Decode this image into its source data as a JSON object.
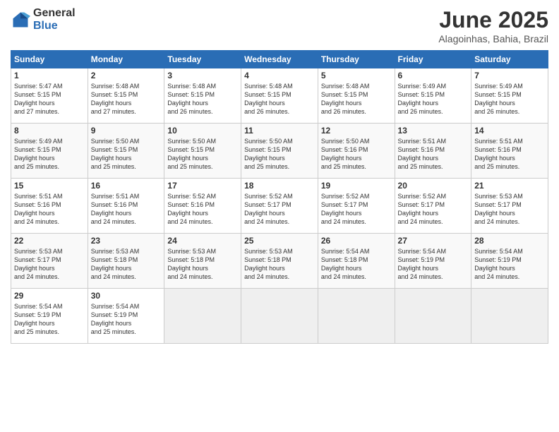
{
  "logo": {
    "general": "General",
    "blue": "Blue"
  },
  "title": "June 2025",
  "location": "Alagoinhas, Bahia, Brazil",
  "days_of_week": [
    "Sunday",
    "Monday",
    "Tuesday",
    "Wednesday",
    "Thursday",
    "Friday",
    "Saturday"
  ],
  "weeks": [
    [
      {
        "day": "1",
        "sunrise": "5:47 AM",
        "sunset": "5:15 PM",
        "daylight": "11 hours and 27 minutes."
      },
      {
        "day": "2",
        "sunrise": "5:48 AM",
        "sunset": "5:15 PM",
        "daylight": "11 hours and 27 minutes."
      },
      {
        "day": "3",
        "sunrise": "5:48 AM",
        "sunset": "5:15 PM",
        "daylight": "11 hours and 26 minutes."
      },
      {
        "day": "4",
        "sunrise": "5:48 AM",
        "sunset": "5:15 PM",
        "daylight": "11 hours and 26 minutes."
      },
      {
        "day": "5",
        "sunrise": "5:48 AM",
        "sunset": "5:15 PM",
        "daylight": "11 hours and 26 minutes."
      },
      {
        "day": "6",
        "sunrise": "5:49 AM",
        "sunset": "5:15 PM",
        "daylight": "11 hours and 26 minutes."
      },
      {
        "day": "7",
        "sunrise": "5:49 AM",
        "sunset": "5:15 PM",
        "daylight": "11 hours and 26 minutes."
      }
    ],
    [
      {
        "day": "8",
        "sunrise": "5:49 AM",
        "sunset": "5:15 PM",
        "daylight": "11 hours and 25 minutes."
      },
      {
        "day": "9",
        "sunrise": "5:50 AM",
        "sunset": "5:15 PM",
        "daylight": "11 hours and 25 minutes."
      },
      {
        "day": "10",
        "sunrise": "5:50 AM",
        "sunset": "5:15 PM",
        "daylight": "11 hours and 25 minutes."
      },
      {
        "day": "11",
        "sunrise": "5:50 AM",
        "sunset": "5:15 PM",
        "daylight": "11 hours and 25 minutes."
      },
      {
        "day": "12",
        "sunrise": "5:50 AM",
        "sunset": "5:16 PM",
        "daylight": "11 hours and 25 minutes."
      },
      {
        "day": "13",
        "sunrise": "5:51 AM",
        "sunset": "5:16 PM",
        "daylight": "11 hours and 25 minutes."
      },
      {
        "day": "14",
        "sunrise": "5:51 AM",
        "sunset": "5:16 PM",
        "daylight": "11 hours and 25 minutes."
      }
    ],
    [
      {
        "day": "15",
        "sunrise": "5:51 AM",
        "sunset": "5:16 PM",
        "daylight": "11 hours and 24 minutes."
      },
      {
        "day": "16",
        "sunrise": "5:51 AM",
        "sunset": "5:16 PM",
        "daylight": "11 hours and 24 minutes."
      },
      {
        "day": "17",
        "sunrise": "5:52 AM",
        "sunset": "5:16 PM",
        "daylight": "11 hours and 24 minutes."
      },
      {
        "day": "18",
        "sunrise": "5:52 AM",
        "sunset": "5:17 PM",
        "daylight": "11 hours and 24 minutes."
      },
      {
        "day": "19",
        "sunrise": "5:52 AM",
        "sunset": "5:17 PM",
        "daylight": "11 hours and 24 minutes."
      },
      {
        "day": "20",
        "sunrise": "5:52 AM",
        "sunset": "5:17 PM",
        "daylight": "11 hours and 24 minutes."
      },
      {
        "day": "21",
        "sunrise": "5:53 AM",
        "sunset": "5:17 PM",
        "daylight": "11 hours and 24 minutes."
      }
    ],
    [
      {
        "day": "22",
        "sunrise": "5:53 AM",
        "sunset": "5:17 PM",
        "daylight": "11 hours and 24 minutes."
      },
      {
        "day": "23",
        "sunrise": "5:53 AM",
        "sunset": "5:18 PM",
        "daylight": "11 hours and 24 minutes."
      },
      {
        "day": "24",
        "sunrise": "5:53 AM",
        "sunset": "5:18 PM",
        "daylight": "11 hours and 24 minutes."
      },
      {
        "day": "25",
        "sunrise": "5:53 AM",
        "sunset": "5:18 PM",
        "daylight": "11 hours and 24 minutes."
      },
      {
        "day": "26",
        "sunrise": "5:54 AM",
        "sunset": "5:18 PM",
        "daylight": "11 hours and 24 minutes."
      },
      {
        "day": "27",
        "sunrise": "5:54 AM",
        "sunset": "5:19 PM",
        "daylight": "11 hours and 24 minutes."
      },
      {
        "day": "28",
        "sunrise": "5:54 AM",
        "sunset": "5:19 PM",
        "daylight": "11 hours and 24 minutes."
      }
    ],
    [
      {
        "day": "29",
        "sunrise": "5:54 AM",
        "sunset": "5:19 PM",
        "daylight": "11 hours and 25 minutes."
      },
      {
        "day": "30",
        "sunrise": "5:54 AM",
        "sunset": "5:19 PM",
        "daylight": "11 hours and 25 minutes."
      },
      null,
      null,
      null,
      null,
      null
    ]
  ]
}
